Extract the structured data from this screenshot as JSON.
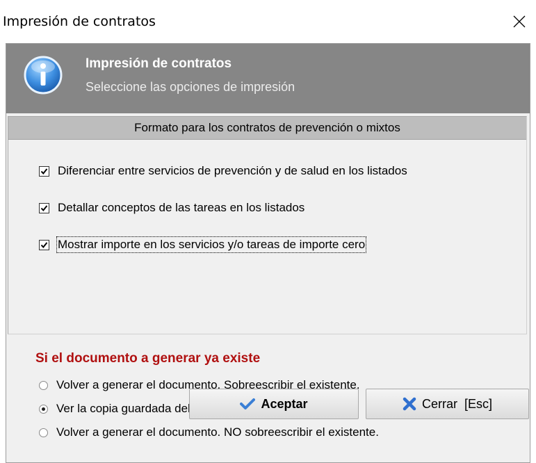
{
  "window": {
    "title": "Impresión de contratos"
  },
  "header": {
    "title": "Impresión de contratos",
    "subtitle": "Seleccione las opciones de impresión",
    "icon": "info-icon"
  },
  "format_section": {
    "title": "Formato para los contratos de prevención o mixtos",
    "options": [
      {
        "label": "Diferenciar entre servicios de prevención y de salud en los listados",
        "checked": true
      },
      {
        "label": "Detallar conceptos de las tareas en los listados",
        "checked": true
      },
      {
        "label": "Mostrar importe en los servicios y/o tareas de importe cero",
        "checked": true
      }
    ]
  },
  "existing_section": {
    "title": "Si el documento a generar ya existe",
    "options": [
      {
        "label": "Volver a generar el documento. Sobreescribir el existente.",
        "selected": false
      },
      {
        "label": "Ver la copia guardada del documento.",
        "selected": true
      },
      {
        "label": "Volver a generar el documento. NO sobreescribir el existente.",
        "selected": false
      }
    ]
  },
  "buttons": {
    "accept_label": "Aceptar",
    "close_label": "Cerrar  [Esc]"
  },
  "colors": {
    "header_bg": "#868686",
    "section_header_bg": "#bdbdbd",
    "warning_title": "#b01010",
    "accept_check": "#3a7fd5",
    "close_x": "#2f6fcf"
  }
}
